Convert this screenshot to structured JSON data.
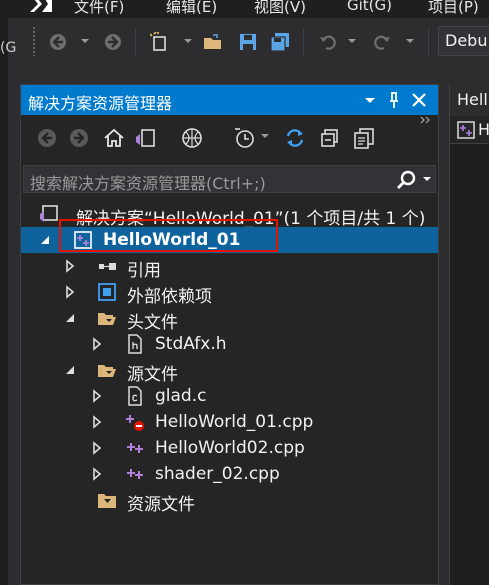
{
  "menubar": {
    "items": [
      "文件(F)",
      "编辑(E)",
      "视图(V)",
      "Git(G)",
      "项目(P)"
    ]
  },
  "left_edge_text": "(G",
  "toolbar": {
    "configuration_value": "Debu"
  },
  "solution_explorer": {
    "title": "解决方案资源管理器",
    "search_placeholder": "搜索解决方案资源管理器(Ctrl+;)",
    "tree": {
      "solution": "解决方案“HelloWorld_01”(1 个项目/共 1 个)",
      "project": "HelloWorld_01",
      "references": "引用",
      "external_dependencies": "外部依赖项",
      "header_files": "头文件",
      "header_file_1": "StdAfx.h",
      "source_files": "源文件",
      "source_file_1": "glad.c",
      "source_file_2": "HelloWorld_01.cpp",
      "source_file_3": "HelloWorld02.cpp",
      "source_file_4": "shader_02.cpp",
      "resource_files": "资源文件"
    }
  },
  "right_panel": {
    "tab_text": "Hell",
    "sub_text": "H"
  },
  "colors": {
    "accent": "#007acc",
    "selection": "#0e639c",
    "highlight_border": "#e51400"
  }
}
